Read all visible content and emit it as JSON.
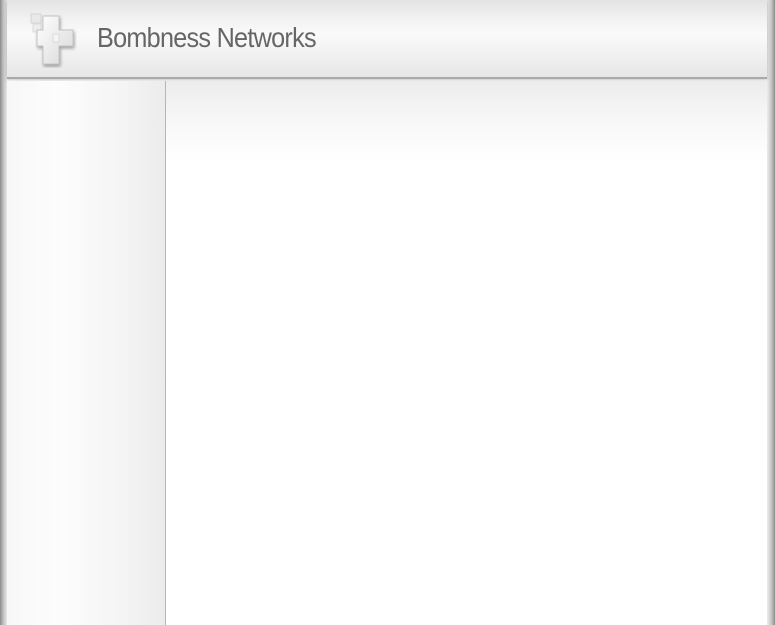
{
  "header": {
    "site_title": "Bombness Networks",
    "logo_icon": "cross-logo-icon"
  },
  "sidebar": {
    "items": []
  },
  "main": {
    "content": ""
  }
}
